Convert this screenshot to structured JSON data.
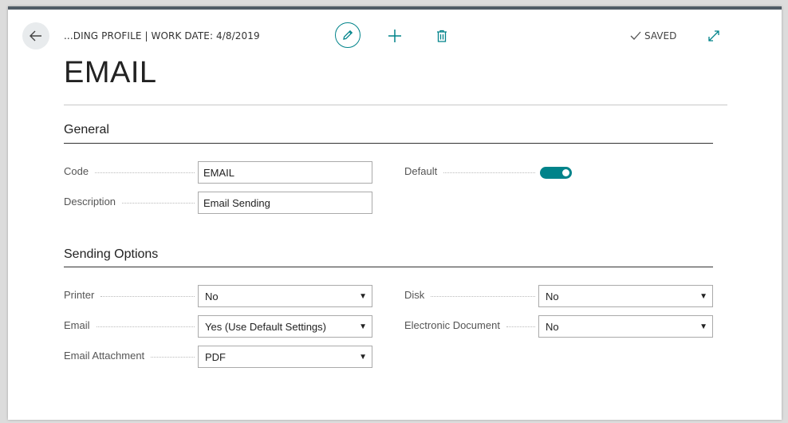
{
  "header": {
    "breadcrumb": "...DING PROFILE | WORK DATE: 4/8/2019",
    "status": "SAVED"
  },
  "page_title": "EMAIL",
  "general": {
    "title": "General",
    "code_label": "Code",
    "code_value": "EMAIL",
    "description_label": "Description",
    "description_value": "Email Sending",
    "default_label": "Default",
    "default_on": true
  },
  "sending_options": {
    "title": "Sending Options",
    "printer_label": "Printer",
    "printer_value": "No",
    "email_label": "Email",
    "email_value": "Yes (Use Default Settings)",
    "email_attachment_label": "Email Attachment",
    "email_attachment_value": "PDF",
    "disk_label": "Disk",
    "disk_value": "No",
    "electronic_document_label": "Electronic Document",
    "electronic_document_value": "No"
  },
  "colors": {
    "accent": "#00838a",
    "header_bar": "#505c66"
  },
  "icons": {
    "back": "arrow-left-icon",
    "edit": "pencil-icon",
    "add": "plus-icon",
    "delete": "trash-icon",
    "saved": "check-icon",
    "expand": "expand-icon",
    "dropdown": "caret-down-icon"
  }
}
